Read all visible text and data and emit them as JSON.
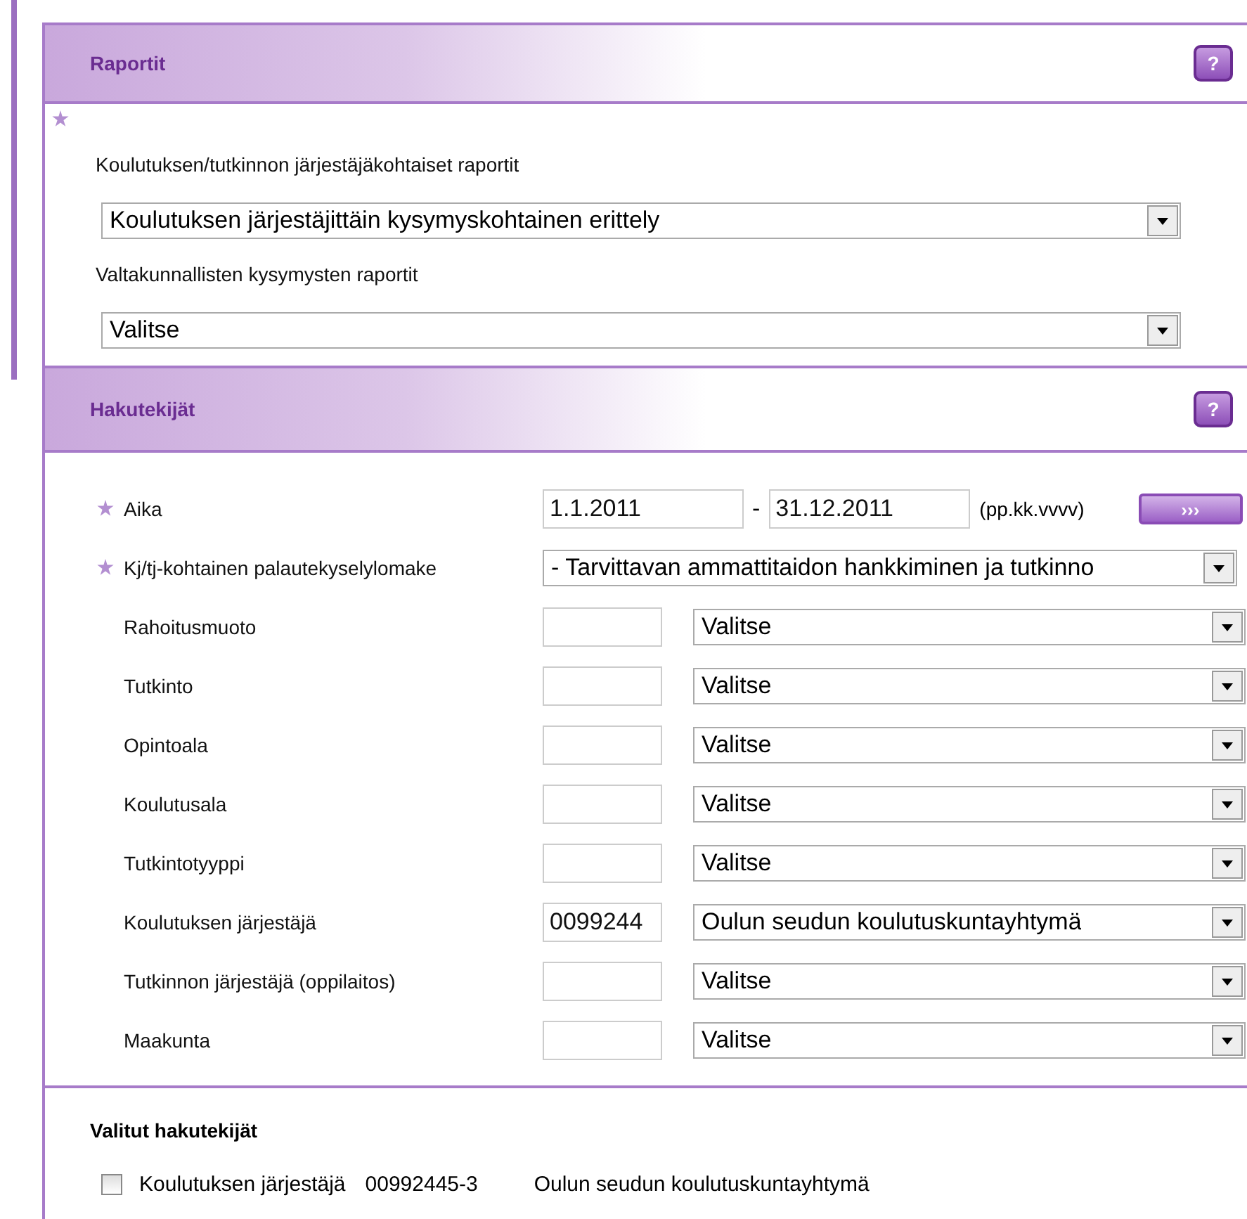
{
  "reports": {
    "title": "Raportit",
    "help": "?",
    "required_note": true,
    "fields": [
      {
        "label": "Koulutuksen/tutkinnon järjestäjäkohtaiset raportit",
        "value": "Koulutuksen järjestäjittäin kysymyskohtainen erittely"
      },
      {
        "label": "Valtakunnallisten kysymysten raportit",
        "value": "Valitse"
      }
    ]
  },
  "criteria": {
    "title": "Hakutekijät",
    "help": "?",
    "rows": [
      {
        "kind": "date_range",
        "label": "Aika",
        "required": true,
        "from": "1.1.2011",
        "separator": "-",
        "to": "31.12.2011",
        "hint": "(pp.kk.vvvv)",
        "button": "›››"
      },
      {
        "kind": "select",
        "label": "Kj/tj-kohtainen palautekyselylomake",
        "required": true,
        "value": "- Tarvittavan ammattitaidon hankkiminen ja tutkinno"
      },
      {
        "kind": "coded_select",
        "label": "Rahoitusmuoto",
        "required": false,
        "value": "Valitse"
      },
      {
        "kind": "coded_select",
        "label": "Tutkinto",
        "required": false,
        "value": "Valitse"
      },
      {
        "kind": "coded_select",
        "label": "Opintoala",
        "required": false,
        "value": "Valitse"
      },
      {
        "kind": "coded_select",
        "label": "Koulutusala",
        "required": false,
        "value": "Valitse"
      },
      {
        "kind": "coded_select",
        "label": "Tutkintotyyppi",
        "required": false,
        "value": "Valitse"
      },
      {
        "kind": "coded_select",
        "label": "Koulutuksen järjestäjä",
        "required": false,
        "code": "0099244",
        "value": "Oulun seudun koulutuskuntayhtymä"
      },
      {
        "kind": "coded_select",
        "label": "Tutkinnon järjestäjä (oppilaitos)",
        "required": false,
        "value": "Valitse"
      },
      {
        "kind": "coded_select",
        "label": "Maakunta",
        "required": false,
        "value": "Valitse"
      }
    ]
  },
  "selected_criteria": {
    "title": "Valitut hakutekijät",
    "items": [
      {
        "checked": false,
        "type": "Koulutuksen järjestäjä",
        "code": "00992445-3",
        "name": "Oulun seudun koulutuskuntayhtymä"
      }
    ]
  }
}
